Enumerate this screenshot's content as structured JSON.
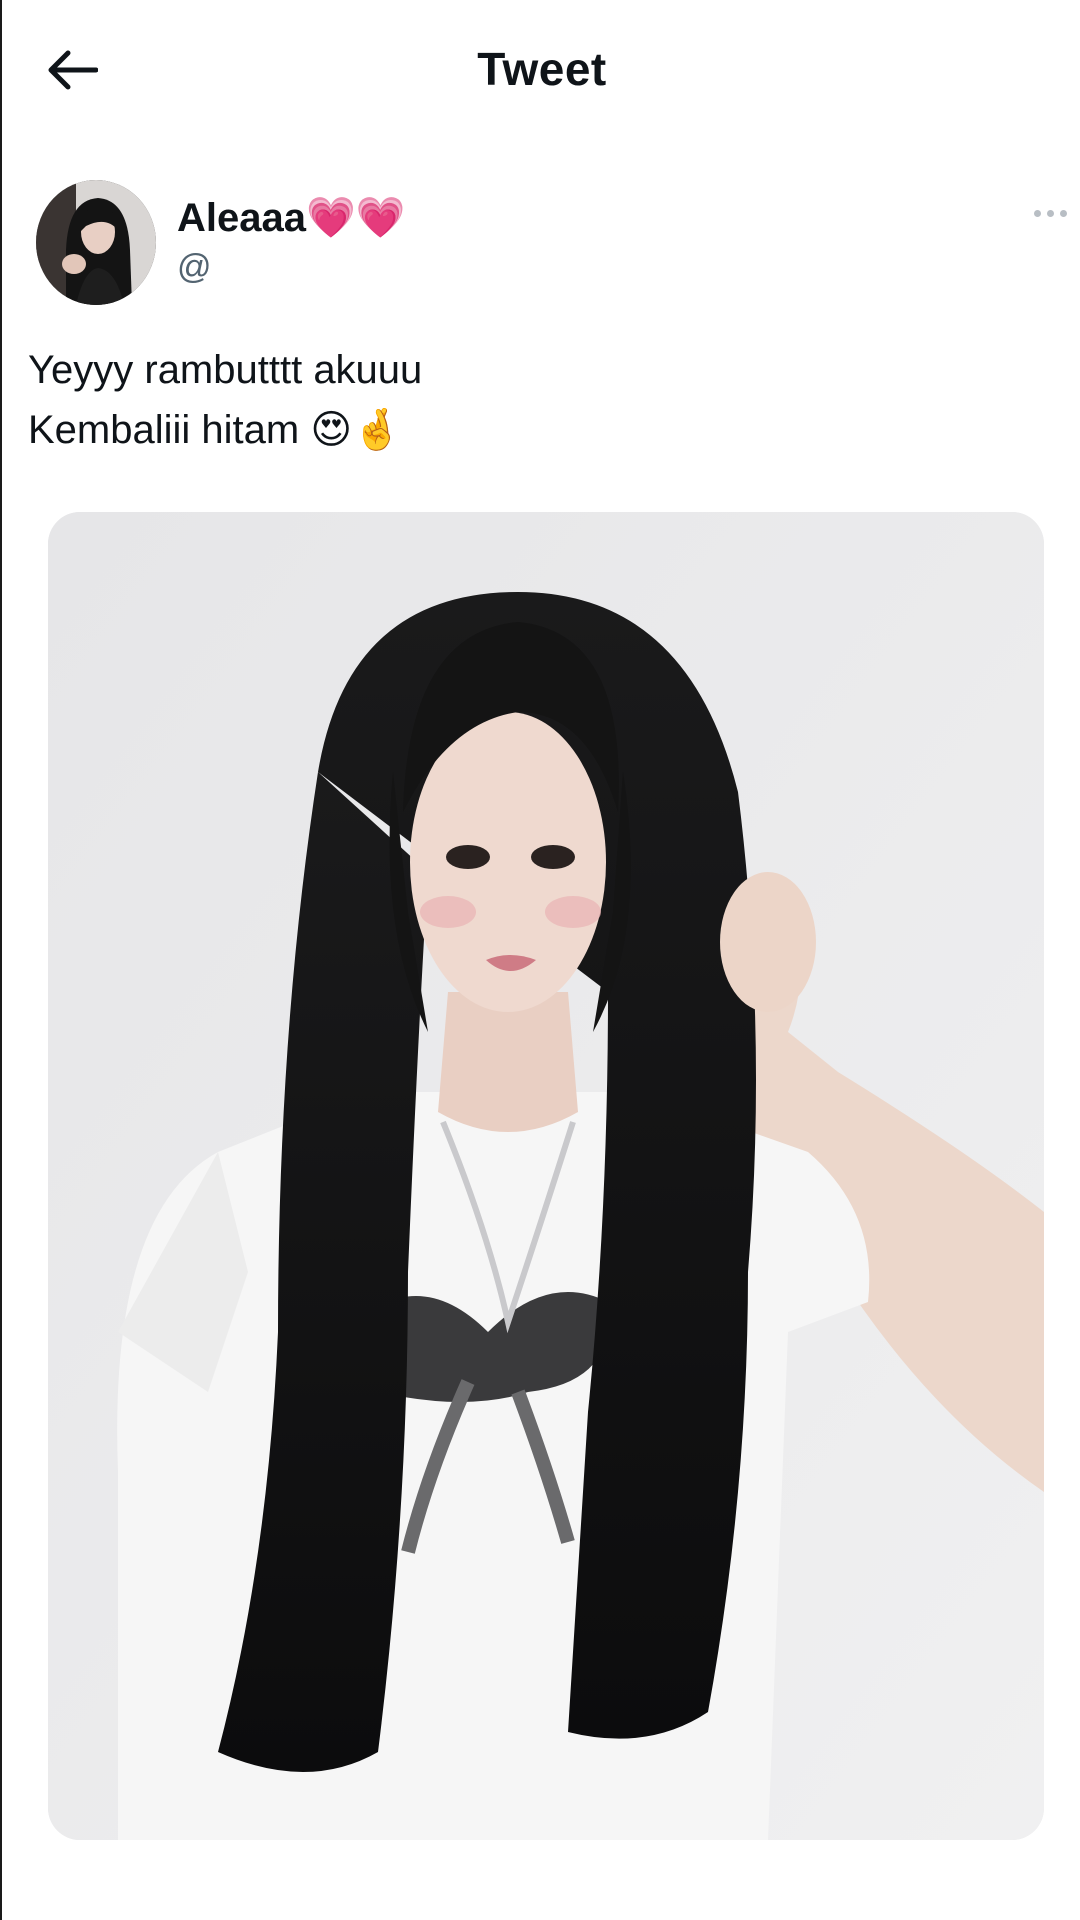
{
  "header": {
    "title": "Tweet",
    "back_icon": "arrow-left-icon"
  },
  "tweet": {
    "author": {
      "display_name": "Aleaaa💗💗",
      "handle": "@"
    },
    "more_icon": "more-horizontal-icon",
    "text_lines": [
      "Yeyyy rambutttt akuuu",
      "Kembaliii hitam 😍🤞"
    ],
    "media": {
      "kind": "photo"
    }
  },
  "colors": {
    "text_primary": "#0f1419",
    "text_secondary": "#536471",
    "background": "#ffffff",
    "photo_wall": "#e9e9ea",
    "hair": "#101010"
  }
}
